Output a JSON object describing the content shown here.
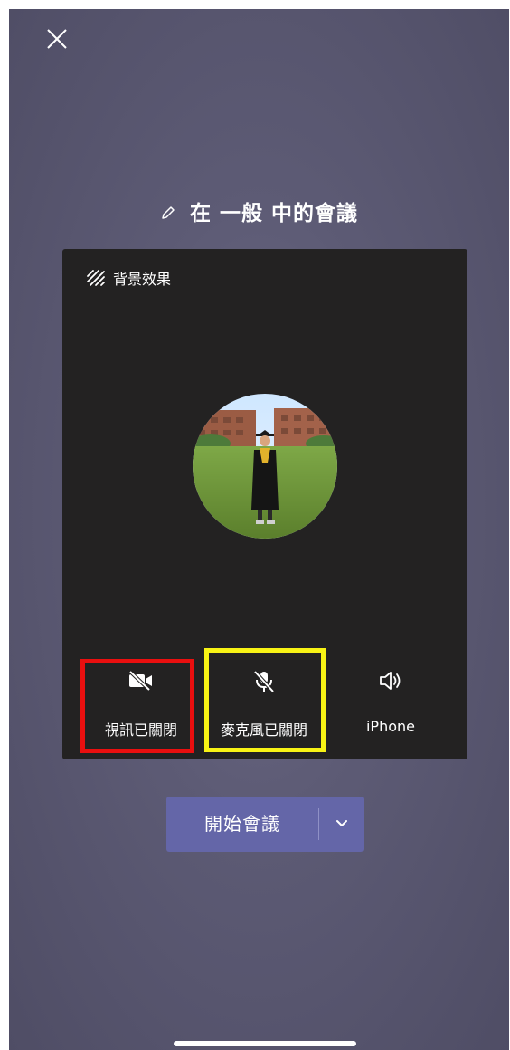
{
  "header": {
    "close_icon": "close-icon",
    "pencil_icon": "pencil-icon",
    "title": "在 一般 中的會議"
  },
  "preview": {
    "background_effects_icon": "background-effects-icon",
    "background_effects_label": "背景效果",
    "avatar": "avatar-photo"
  },
  "controls": {
    "camera": {
      "icon": "camera-off-icon",
      "label": "視訊已關閉"
    },
    "mic": {
      "icon": "mic-off-icon",
      "label": "麥克風已關閉"
    },
    "audio": {
      "icon": "speaker-icon",
      "label": "iPhone"
    }
  },
  "actions": {
    "join_label": "開始會議",
    "dropdown_icon": "chevron-down-icon"
  },
  "colors": {
    "highlight_red": "#e90f0f",
    "highlight_yellow": "#f8f315",
    "accent": "#6466a8"
  }
}
